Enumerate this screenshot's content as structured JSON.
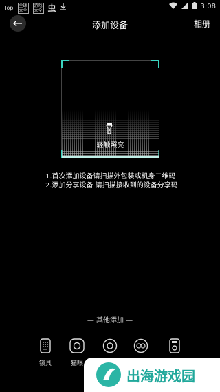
{
  "status_bar": {
    "left_badges": [
      "Top",
      "全球\n大全",
      "游戏\n大全",
      "虫",
      "download-icon"
    ],
    "time": "3:08"
  },
  "header": {
    "title": "添加设备",
    "album_label": "相册"
  },
  "scanner": {
    "light_label": "轻触照亮",
    "accent_color": "#3bd4c0"
  },
  "hints": {
    "line1": "1.首次添加设备请扫描外包装或机身二维码",
    "line2": "2.添加分享设备 请扫描接收到的设备分享码"
  },
  "other_add": {
    "label": "— 其他添加 —",
    "devices": [
      {
        "label": "锁具",
        "icon": "lock-icon"
      },
      {
        "label": "猫眼",
        "icon": "peephole-icon"
      },
      {
        "label": "",
        "icon": "camera-icon"
      },
      {
        "label": "",
        "icon": "device-icon"
      },
      {
        "label": "",
        "icon": "doorbell-icon"
      }
    ]
  },
  "watermark": {
    "text": "出海游戏园"
  }
}
